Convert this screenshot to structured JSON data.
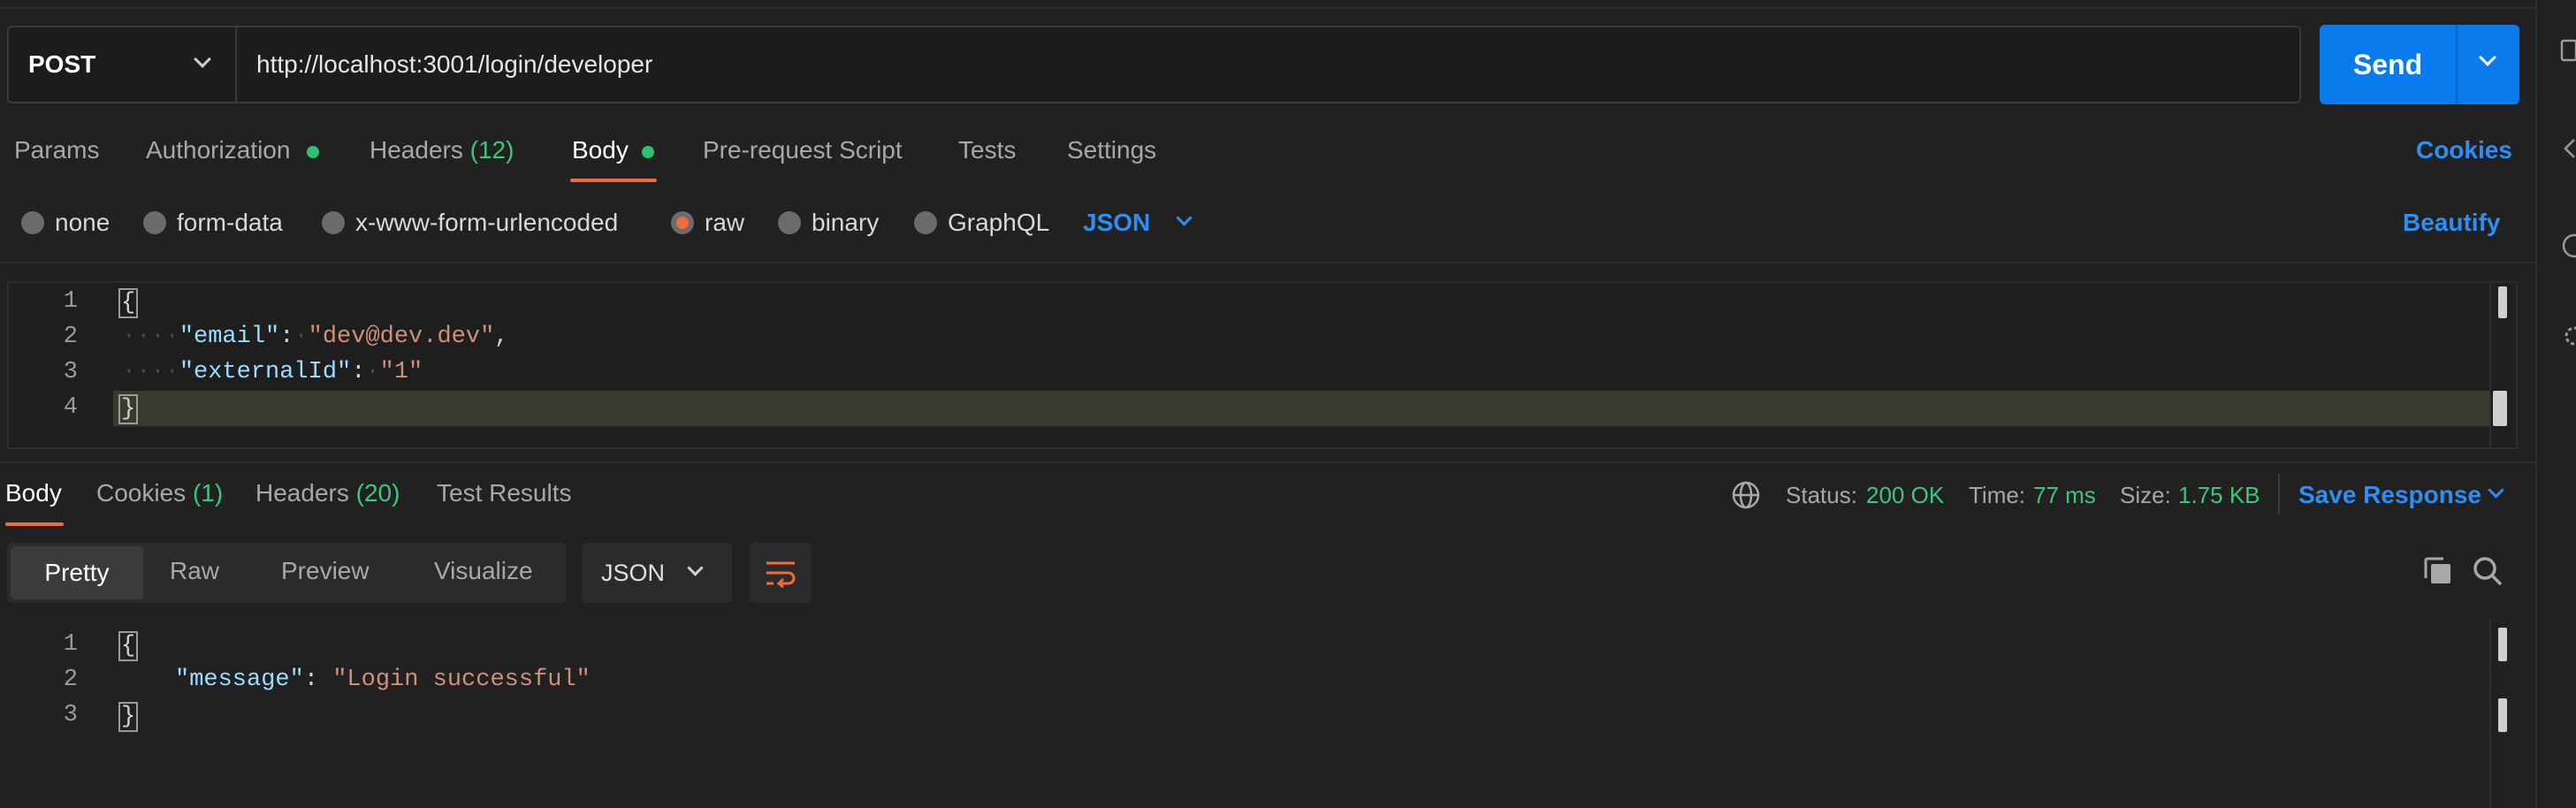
{
  "request": {
    "method": "POST",
    "url": "http://localhost:3001/login/developer",
    "send_label": "Send"
  },
  "tabs": {
    "params": "Params",
    "authorization": "Authorization",
    "headers": "Headers",
    "headers_count": "(12)",
    "body": "Body",
    "prerequest": "Pre-request Script",
    "tests": "Tests",
    "settings": "Settings",
    "cookies": "Cookies"
  },
  "body_types": {
    "none": "none",
    "form_data": "form-data",
    "urlencoded": "x-www-form-urlencoded",
    "raw": "raw",
    "binary": "binary",
    "graphql": "GraphQL",
    "format": "JSON",
    "beautify": "Beautify",
    "selected": "raw"
  },
  "request_body": {
    "line_numbers": [
      "1",
      "2",
      "3",
      "4"
    ],
    "open": "{",
    "close": "}",
    "email_key": "\"email\"",
    "email_value": "\"dev@dev.dev\"",
    "external_key": "\"externalId\"",
    "external_value": "\"1\""
  },
  "response": {
    "tabs": {
      "body": "Body",
      "cookies": "Cookies",
      "cookies_count": "(1)",
      "headers": "Headers",
      "headers_count": "(20)",
      "test_results": "Test Results"
    },
    "status_label": "Status:",
    "status_value": "200 OK",
    "time_label": "Time:",
    "time_value": "77 ms",
    "size_label": "Size:",
    "size_value": "1.75 KB",
    "save_response": "Save Response",
    "views": {
      "pretty": "Pretty",
      "raw": "Raw",
      "preview": "Preview",
      "visualize": "Visualize"
    },
    "format": "JSON",
    "body": {
      "line_numbers": [
        "1",
        "2",
        "3"
      ],
      "open": "{",
      "close": "}",
      "message_key": "\"message\"",
      "message_value": "\"Login successful\""
    }
  },
  "colors": {
    "accent_blue": "#097bed",
    "accent_orange": "#f26b3a",
    "status_green": "#3fc67a"
  }
}
